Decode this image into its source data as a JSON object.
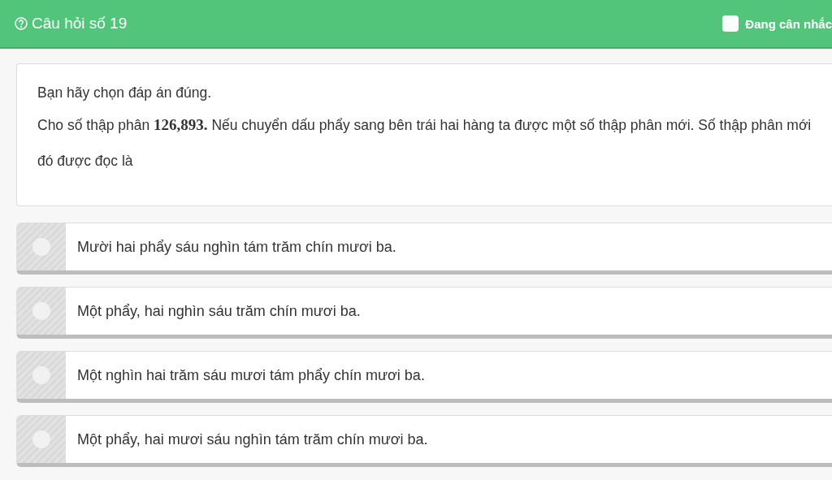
{
  "header": {
    "title": "Câu hỏi số 19",
    "flag": {
      "label": "Đang cân nhắc",
      "checked": false
    }
  },
  "question": {
    "instruction": "Bạn hãy chọn đáp án đúng.",
    "text": "Cho số thập phân **126,893.** Nếu chuyển dấu phẩy sang bên trái hai hàng ta được một số thập phân mới. Số thập phân mới đó được đọc là"
  },
  "options": [
    {
      "label": "Mười hai phẩy sáu nghìn tám trăm chín mươi ba.",
      "selected": false
    },
    {
      "label": "Một phẩy, hai nghìn sáu trăm chín mươi ba.",
      "selected": false
    },
    {
      "label": "Một nghìn hai trăm sáu mươi tám phẩy chín mươi ba.",
      "selected": false
    },
    {
      "label": "Một phẩy, hai mươi sáu nghìn tám trăm chín mươi ba.",
      "selected": false
    }
  ]
}
